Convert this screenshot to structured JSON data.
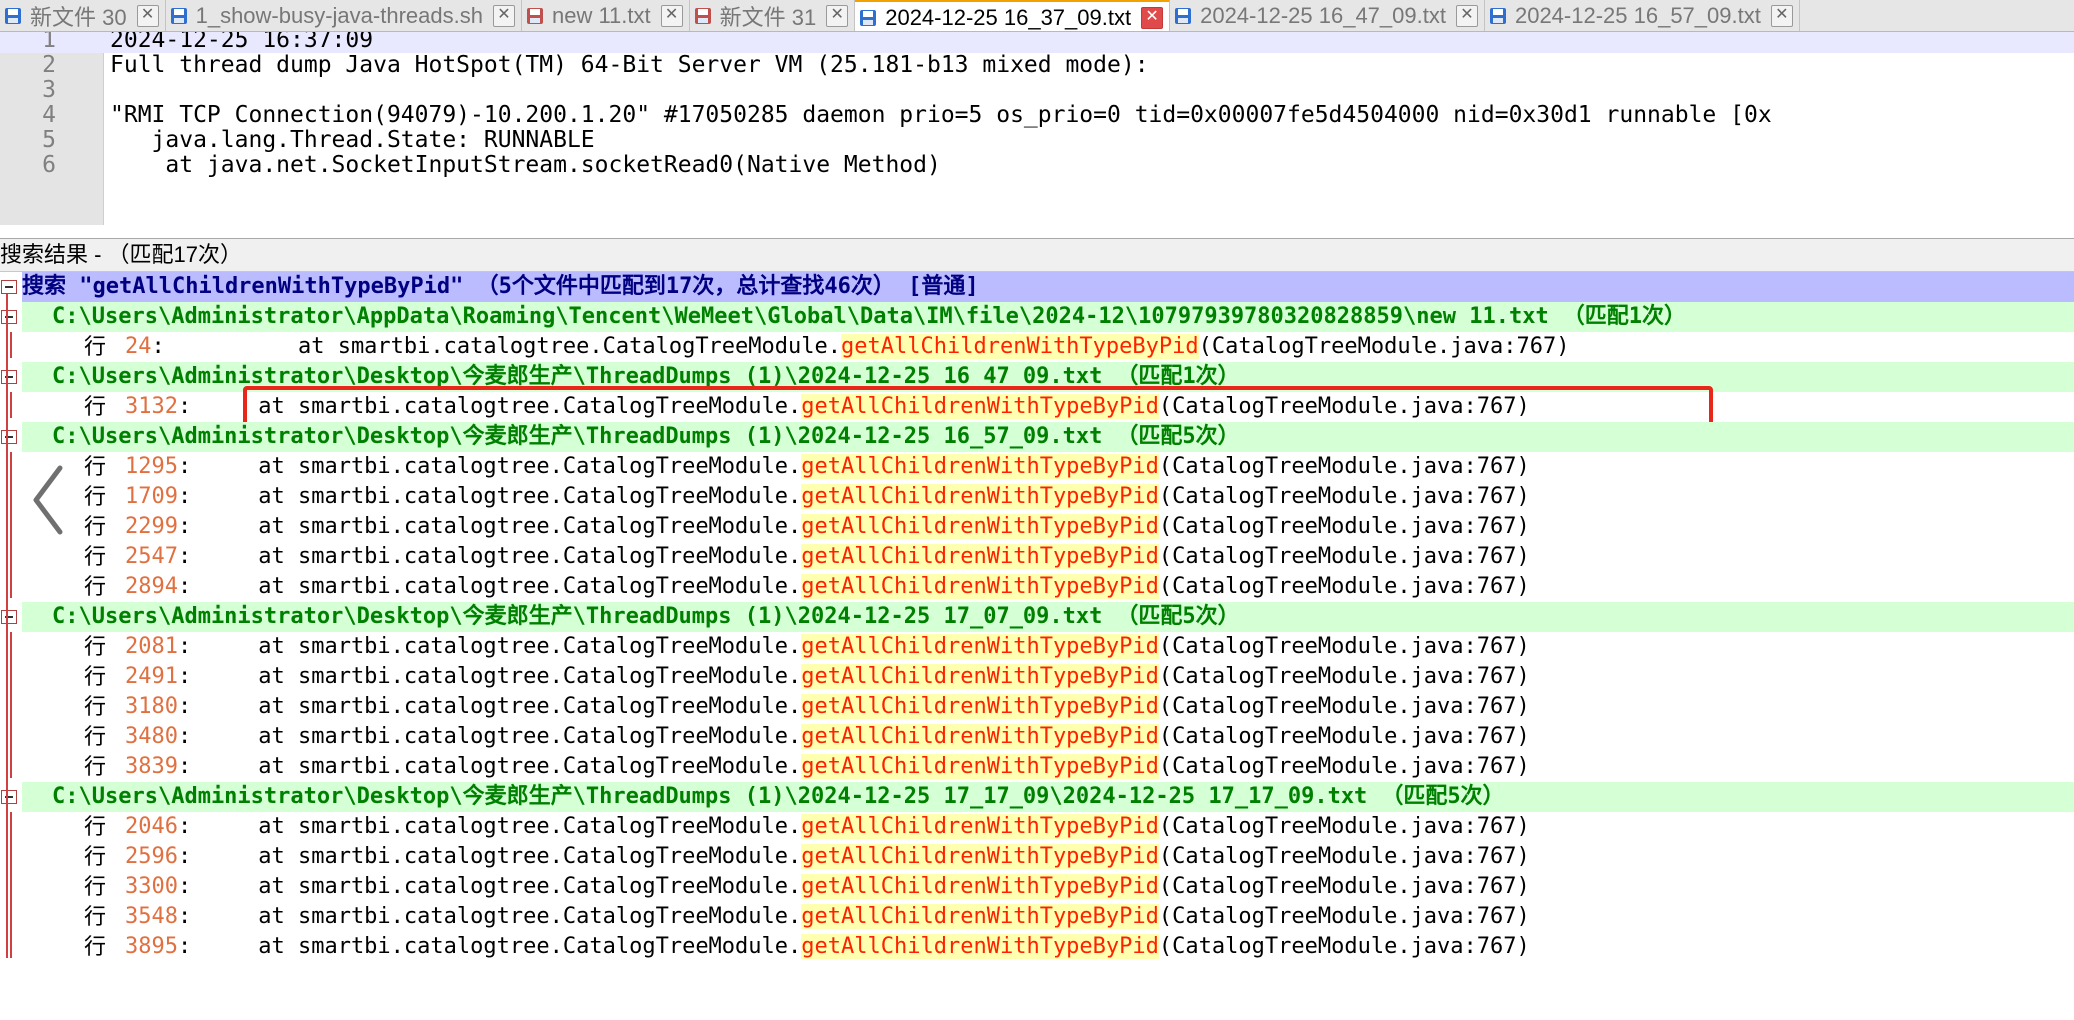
{
  "tabs": [
    {
      "label": "新文件 30",
      "icon": "file-saved-icon",
      "active": false
    },
    {
      "label": "1_show-busy-java-threads.sh",
      "icon": "file-saved-icon",
      "active": false
    },
    {
      "label": "new 11.txt",
      "icon": "file-unsaved-icon",
      "active": false
    },
    {
      "label": "新文件 31",
      "icon": "file-unsaved-icon",
      "active": false
    },
    {
      "label": "2024-12-25 16_37_09.txt",
      "icon": "file-saved-icon",
      "active": true
    },
    {
      "label": "2024-12-25 16_47_09.txt",
      "icon": "file-saved-icon",
      "active": false
    },
    {
      "label": "2024-12-25 16_57_09.txt",
      "icon": "file-saved-icon",
      "active": false
    }
  ],
  "editor": {
    "lines": [
      {
        "no": "1",
        "text": "2024-12-25 16:37:09"
      },
      {
        "no": "2",
        "text": "Full thread dump Java HotSpot(TM) 64-Bit Server VM (25.181-b13 mixed mode):"
      },
      {
        "no": "3",
        "text": ""
      },
      {
        "no": "4",
        "text": "\"RMI TCP Connection(94079)-10.200.1.20\" #17050285 daemon prio=5 os_prio=0 tid=0x00007fe5d4504000 nid=0x30d1 runnable [0x"
      },
      {
        "no": "5",
        "text": "   java.lang.Thread.State: RUNNABLE"
      },
      {
        "no": "6",
        "text": "    at java.net.SocketInputStream.socketRead0(Native Method)"
      }
    ]
  },
  "search": {
    "header": "搜索结果 - （匹配17次）",
    "summary": "搜索 \"getAllChildrenWithTypeByPid\" （5个文件中匹配到17次，总计查找46次） [普通]",
    "hang_label": "行",
    "term": "getAllChildrenWithTypeByPid",
    "files": [
      {
        "path": "C:\\Users\\Administrator\\AppData\\Roaming\\Tencent\\WeMeet\\Global\\Data\\IM\\file\\2024-12\\10797939780320828859\\new 11.txt",
        "count": "（匹配1次）",
        "hits": [
          {
            "line": "24",
            "before": "        at smartbi.catalogtree.CatalogTreeModule.",
            "after": "(CatalogTreeModule.java:767)"
          }
        ]
      },
      {
        "path": "C:\\Users\\Administrator\\Desktop\\今麦郎生产\\ThreadDumps (1)\\2024-12-25 16_47_09.txt",
        "count": "（匹配1次）",
        "hits": [
          {
            "line": "3132",
            "before": "     at smartbi.catalogtree.CatalogTreeModule.",
            "after": "(CatalogTreeModule.java:767)"
          }
        ]
      },
      {
        "path": "C:\\Users\\Administrator\\Desktop\\今麦郎生产\\ThreadDumps (1)\\2024-12-25 16_57_09.txt",
        "count": "（匹配5次）",
        "hits": [
          {
            "line": "1295",
            "before": "     at smartbi.catalogtree.CatalogTreeModule.",
            "after": "(CatalogTreeModule.java:767)"
          },
          {
            "line": "1709",
            "before": "     at smartbi.catalogtree.CatalogTreeModule.",
            "after": "(CatalogTreeModule.java:767)"
          },
          {
            "line": "2299",
            "before": "     at smartbi.catalogtree.CatalogTreeModule.",
            "after": "(CatalogTreeModule.java:767)"
          },
          {
            "line": "2547",
            "before": "     at smartbi.catalogtree.CatalogTreeModule.",
            "after": "(CatalogTreeModule.java:767)"
          },
          {
            "line": "2894",
            "before": "     at smartbi.catalogtree.CatalogTreeModule.",
            "after": "(CatalogTreeModule.java:767)"
          }
        ]
      },
      {
        "path": "C:\\Users\\Administrator\\Desktop\\今麦郎生产\\ThreadDumps (1)\\2024-12-25 17_07_09.txt",
        "count": "（匹配5次）",
        "hits": [
          {
            "line": "2081",
            "before": "     at smartbi.catalogtree.CatalogTreeModule.",
            "after": "(CatalogTreeModule.java:767)"
          },
          {
            "line": "2491",
            "before": "     at smartbi.catalogtree.CatalogTreeModule.",
            "after": "(CatalogTreeModule.java:767)"
          },
          {
            "line": "3180",
            "before": "     at smartbi.catalogtree.CatalogTreeModule.",
            "after": "(CatalogTreeModule.java:767)"
          },
          {
            "line": "3480",
            "before": "     at smartbi.catalogtree.CatalogTreeModule.",
            "after": "(CatalogTreeModule.java:767)"
          },
          {
            "line": "3839",
            "before": "     at smartbi.catalogtree.CatalogTreeModule.",
            "after": "(CatalogTreeModule.java:767)"
          }
        ]
      },
      {
        "path": "C:\\Users\\Administrator\\Desktop\\今麦郎生产\\ThreadDumps (1)\\2024-12-25 17_17_09\\2024-12-25 17_17_09.txt",
        "count": "（匹配5次）",
        "hits": [
          {
            "line": "2046",
            "before": "     at smartbi.catalogtree.CatalogTreeModule.",
            "after": "(CatalogTreeModule.java:767)"
          },
          {
            "line": "2596",
            "before": "     at smartbi.catalogtree.CatalogTreeModule.",
            "after": "(CatalogTreeModule.java:767)"
          },
          {
            "line": "3300",
            "before": "     at smartbi.catalogtree.CatalogTreeModule.",
            "after": "(CatalogTreeModule.java:767)"
          },
          {
            "line": "3548",
            "before": "     at smartbi.catalogtree.CatalogTreeModule.",
            "after": "(CatalogTreeModule.java:767)"
          },
          {
            "line": "3895",
            "before": "     at smartbi.catalogtree.CatalogTreeModule.",
            "after": "(CatalogTreeModule.java:767)"
          }
        ]
      }
    ],
    "highlighted_hit": "3132"
  },
  "colors": {
    "summary_bg": "#bbbbff",
    "file_bg": "#d5ffd5",
    "file_text": "#008000",
    "term_text": "#ff2200",
    "term_bg": "#ffffb0",
    "line_no": "#e07040",
    "highlight_box": "#e8261a"
  }
}
